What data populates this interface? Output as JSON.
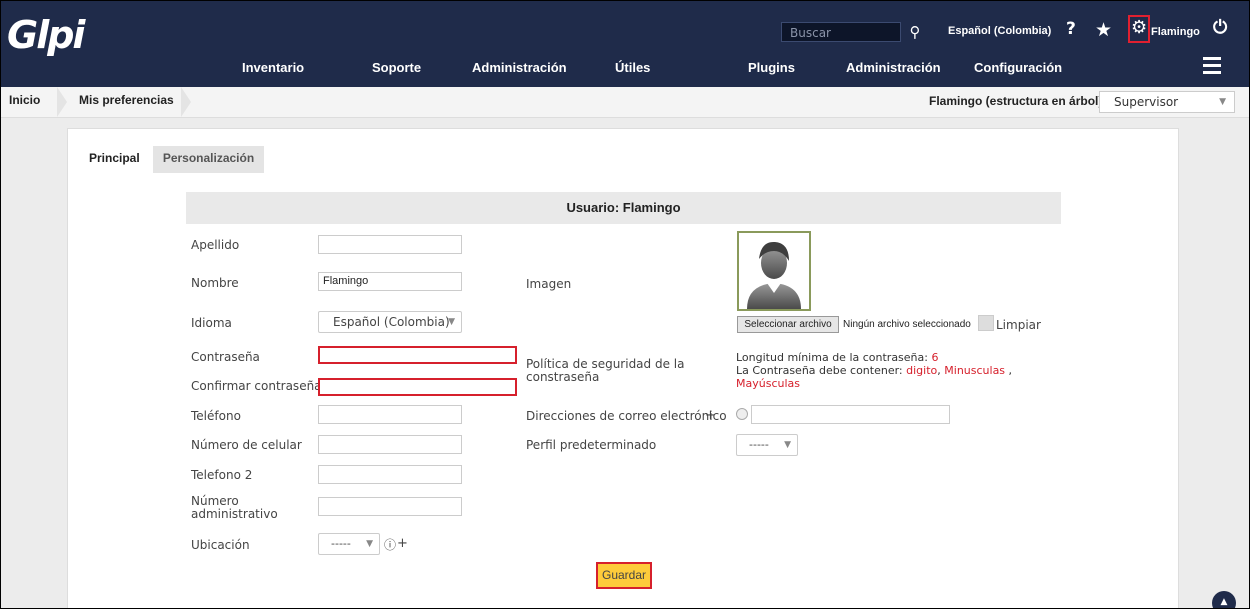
{
  "app": {
    "logo": "Glpi"
  },
  "header": {
    "search_placeholder": "Buscar",
    "language": "Español (Colombia)",
    "help": "?",
    "username": "Flamingo"
  },
  "nav": {
    "items": [
      "Inventario",
      "Soporte",
      "Administración",
      "Útiles",
      "Plugins",
      "Administración",
      "Configuración"
    ]
  },
  "breadcrumb": {
    "items": [
      "Inicio",
      "Mis preferencias"
    ],
    "entity": "Flamingo (estructura en árbol)",
    "profile": "Supervisor"
  },
  "tabs": [
    "Principal",
    "Personalización"
  ],
  "form": {
    "title": "Usuario: Flamingo",
    "fields": {
      "apellido": {
        "label": "Apellido",
        "value": ""
      },
      "nombre": {
        "label": "Nombre",
        "value": "Flamingo"
      },
      "idioma": {
        "label": "Idioma",
        "value": "Español (Colombia)"
      },
      "contrasena": {
        "label": "Contraseña",
        "value": ""
      },
      "confirmar": {
        "label": "Confirmar contraseña",
        "value": ""
      },
      "telefono": {
        "label": "Teléfono",
        "value": ""
      },
      "celular": {
        "label": "Número de celular",
        "value": ""
      },
      "telefono2": {
        "label": "Telefono 2",
        "value": ""
      },
      "administrativo": {
        "label": "Número administrativo",
        "value": ""
      },
      "ubicacion": {
        "label": "Ubicación",
        "value": "-----"
      }
    },
    "imagen": {
      "label": "Imagen",
      "button": "Seleccionar archivo",
      "status": "Ningún archivo seleccionado",
      "clear": "Limpiar"
    },
    "password_policy": {
      "label": "Política de seguridad de la constraseña",
      "min_length_text": "Longitud mínima de la contraseña:",
      "min_length": "6",
      "must_contain_text": "La Contraseña debe contener:",
      "req1": "digito",
      "req2": "Minusculas",
      "req3": "Mayúsculas"
    },
    "email": {
      "label": "Direcciones de correo electrónico",
      "add": "+"
    },
    "perfil": {
      "label": "Perfil predeterminado",
      "value": "-----"
    },
    "save": "Guardar"
  },
  "colors": {
    "nav_bg": "#1f2b4a",
    "highlight": "#d6202c",
    "save_bg": "#fecb3b"
  }
}
